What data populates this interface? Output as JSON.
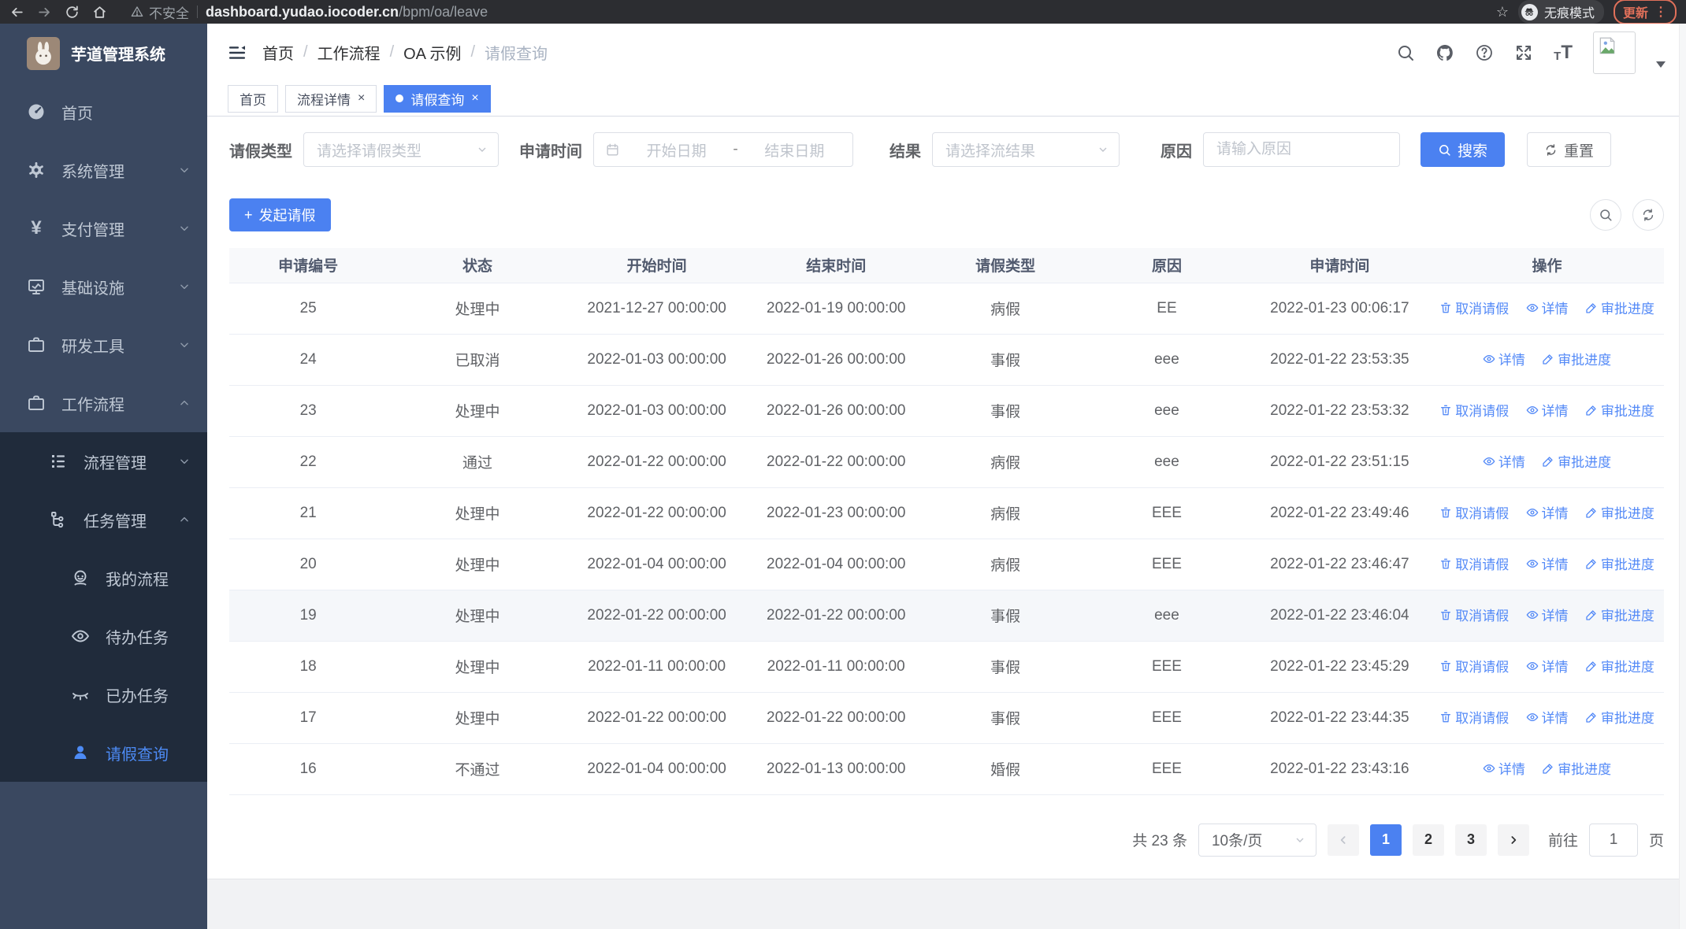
{
  "browser": {
    "security_label": "不安全",
    "url_domain": "dashboard.yudao.iocoder.cn",
    "url_path": "/bpm/oa/leave",
    "incognito_label": "无痕模式",
    "update_label": "更新"
  },
  "icons": {
    "star": "☆",
    "menu_dots": "⋮",
    "tab_close": "×",
    "breadcrumb_separator": "/",
    "plus": "+",
    "yen": "¥",
    "font_small": "T",
    "font_big": "T"
  },
  "sidebar": {
    "title": "芋道管理系统",
    "items": [
      {
        "label": "首页",
        "icon": "gauge-icon",
        "level": 0
      },
      {
        "label": "系统管理",
        "icon": "gear-icon",
        "level": 0,
        "expanded": false
      },
      {
        "label": "支付管理",
        "icon": "yen-icon",
        "level": 0,
        "expanded": false
      },
      {
        "label": "基础设施",
        "icon": "monitor-icon",
        "level": 0,
        "expanded": false
      },
      {
        "label": "研发工具",
        "icon": "briefcase-icon",
        "level": 0,
        "expanded": false
      },
      {
        "label": "工作流程",
        "icon": "briefcase-icon",
        "level": 0,
        "expanded": true
      },
      {
        "label": "流程管理",
        "icon": "list-tree-icon",
        "level": 1,
        "expanded": false
      },
      {
        "label": "任务管理",
        "icon": "org-tree-icon",
        "level": 1,
        "expanded": true
      },
      {
        "label": "我的流程",
        "icon": "user-smile-icon",
        "level": 2
      },
      {
        "label": "待办任务",
        "icon": "eye-open-icon",
        "level": 2
      },
      {
        "label": "已办任务",
        "icon": "eye-closed-icon",
        "level": 2
      },
      {
        "label": "请假查询",
        "icon": "user-icon",
        "level": 2,
        "active": true
      }
    ]
  },
  "header": {
    "breadcrumb": [
      "首页",
      "工作流程",
      "OA 示例",
      "请假查询"
    ]
  },
  "tabs": [
    {
      "label": "首页",
      "closable": false,
      "active": false
    },
    {
      "label": "流程详情",
      "closable": true,
      "active": false
    },
    {
      "label": "请假查询",
      "closable": true,
      "active": true
    }
  ],
  "filters": {
    "leave_type_label": "请假类型",
    "leave_type_placeholder": "请选择请假类型",
    "apply_time_label": "申请时间",
    "start_date_placeholder": "开始日期",
    "date_separator": "-",
    "end_date_placeholder": "结束日期",
    "result_label": "结果",
    "result_placeholder": "请选择流结果",
    "reason_label": "原因",
    "reason_placeholder": "请输入原因",
    "search_button": "搜索",
    "reset_button": "重置"
  },
  "toolbar": {
    "create_button": "发起请假"
  },
  "table": {
    "columns": [
      "申请编号",
      "状态",
      "开始时间",
      "结束时间",
      "请假类型",
      "原因",
      "申请时间",
      "操作"
    ],
    "action_labels": {
      "cancel": "取消请假",
      "detail": "详情",
      "progress": "审批进度"
    },
    "rows": [
      {
        "id": "25",
        "status": "处理中",
        "start": "2021-12-27 00:00:00",
        "end": "2022-01-19 00:00:00",
        "type": "病假",
        "reason": "EE",
        "apply_time": "2022-01-23 00:06:17",
        "actions": [
          "cancel",
          "detail",
          "progress"
        ]
      },
      {
        "id": "24",
        "status": "已取消",
        "start": "2022-01-03 00:00:00",
        "end": "2022-01-26 00:00:00",
        "type": "事假",
        "reason": "eee",
        "apply_time": "2022-01-22 23:53:35",
        "actions": [
          "detail",
          "progress"
        ]
      },
      {
        "id": "23",
        "status": "处理中",
        "start": "2022-01-03 00:00:00",
        "end": "2022-01-26 00:00:00",
        "type": "事假",
        "reason": "eee",
        "apply_time": "2022-01-22 23:53:32",
        "actions": [
          "cancel",
          "detail",
          "progress"
        ]
      },
      {
        "id": "22",
        "status": "通过",
        "start": "2022-01-22 00:00:00",
        "end": "2022-01-22 00:00:00",
        "type": "病假",
        "reason": "eee",
        "apply_time": "2022-01-22 23:51:15",
        "actions": [
          "detail",
          "progress"
        ]
      },
      {
        "id": "21",
        "status": "处理中",
        "start": "2022-01-22 00:00:00",
        "end": "2022-01-23 00:00:00",
        "type": "病假",
        "reason": "EEE",
        "apply_time": "2022-01-22 23:49:46",
        "actions": [
          "cancel",
          "detail",
          "progress"
        ]
      },
      {
        "id": "20",
        "status": "处理中",
        "start": "2022-01-04 00:00:00",
        "end": "2022-01-04 00:00:00",
        "type": "病假",
        "reason": "EEE",
        "apply_time": "2022-01-22 23:46:47",
        "actions": [
          "cancel",
          "detail",
          "progress"
        ]
      },
      {
        "id": "19",
        "status": "处理中",
        "start": "2022-01-22 00:00:00",
        "end": "2022-01-22 00:00:00",
        "type": "事假",
        "reason": "eee",
        "apply_time": "2022-01-22 23:46:04",
        "actions": [
          "cancel",
          "detail",
          "progress"
        ],
        "hover": true
      },
      {
        "id": "18",
        "status": "处理中",
        "start": "2022-01-11 00:00:00",
        "end": "2022-01-11 00:00:00",
        "type": "事假",
        "reason": "EEE",
        "apply_time": "2022-01-22 23:45:29",
        "actions": [
          "cancel",
          "detail",
          "progress"
        ]
      },
      {
        "id": "17",
        "status": "处理中",
        "start": "2022-01-22 00:00:00",
        "end": "2022-01-22 00:00:00",
        "type": "事假",
        "reason": "EEE",
        "apply_time": "2022-01-22 23:44:35",
        "actions": [
          "cancel",
          "detail",
          "progress"
        ]
      },
      {
        "id": "16",
        "status": "不通过",
        "start": "2022-01-04 00:00:00",
        "end": "2022-01-13 00:00:00",
        "type": "婚假",
        "reason": "EEE",
        "apply_time": "2022-01-22 23:43:16",
        "actions": [
          "detail",
          "progress"
        ]
      }
    ]
  },
  "pagination": {
    "total": "共 23 条",
    "page_size": "10条/页",
    "pages": [
      "1",
      "2",
      "3"
    ],
    "active_page": "1",
    "goto_label": "前往",
    "goto_value": "1",
    "page_label": "页"
  },
  "colors": {
    "primary_blue": "#4b81f1",
    "link_blue": "#548af7",
    "sidebar_bg": "#3a4860",
    "sidebar_submenu_bg": "#202b3b",
    "update_orange": "#e0705a"
  }
}
